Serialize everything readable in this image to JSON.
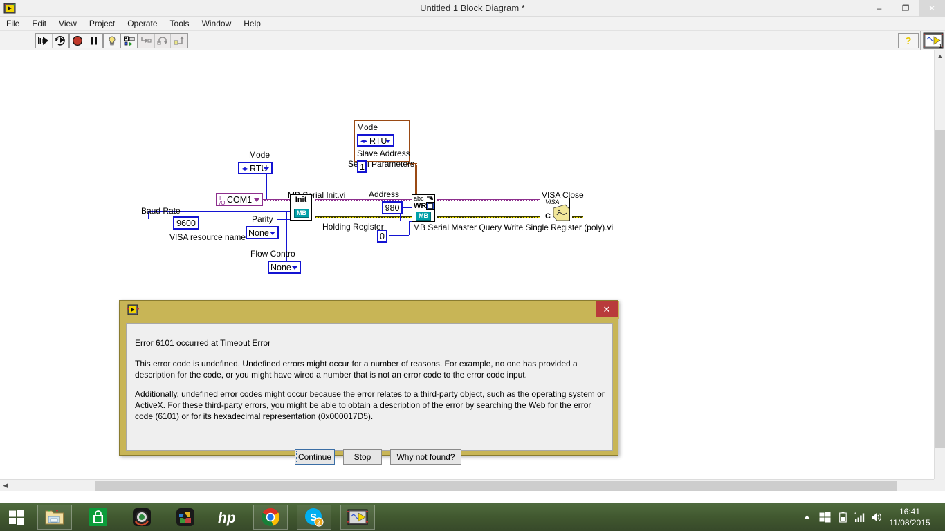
{
  "window": {
    "title": "Untitled 1 Block Diagram *",
    "app_icon": "labview-icon",
    "minimize": "–",
    "maximize": "❐",
    "close": "✕"
  },
  "menubar": {
    "items": [
      {
        "label": "File"
      },
      {
        "label": "Edit"
      },
      {
        "label": "View"
      },
      {
        "label": "Project"
      },
      {
        "label": "Operate"
      },
      {
        "label": "Tools"
      },
      {
        "label": "Window"
      },
      {
        "label": "Help"
      }
    ]
  },
  "toolbar": {
    "buttons": [
      {
        "name": "run-button",
        "icon": "run-arrow-icon"
      },
      {
        "name": "run-continuously-button",
        "icon": "run-continuous-icon"
      },
      {
        "name": "abort-execution-button",
        "icon": "abort-stop-icon"
      },
      {
        "name": "pause-button",
        "icon": "pause-icon"
      },
      {
        "name": "highlight-execution-button",
        "icon": "lightbulb-icon"
      },
      {
        "name": "retain-wire-values-button",
        "icon": "retain-wire-values-icon"
      },
      {
        "name": "step-into-button",
        "icon": "step-into-icon"
      },
      {
        "name": "step-over-button",
        "icon": "step-over-icon"
      },
      {
        "name": "step-out-button",
        "icon": "step-out-icon"
      }
    ],
    "help_button": "?",
    "vi_icon_number": "1"
  },
  "diagram": {
    "controls": [
      {
        "name": "mode-label",
        "text": "Mode"
      },
      {
        "name": "mode-ring-control",
        "value": "RTU"
      },
      {
        "name": "visa-resource-name-label",
        "text": "VISA resource name"
      },
      {
        "name": "visa-resource-name-control",
        "value": "COM1"
      },
      {
        "name": "baud-rate-label",
        "text": "Baud Rate"
      },
      {
        "name": "baud-rate-control",
        "value": "9600"
      },
      {
        "name": "parity-label",
        "text": "Parity"
      },
      {
        "name": "parity-control",
        "value": "None"
      },
      {
        "name": "flow-control-label",
        "text": "Flow Contro"
      },
      {
        "name": "flow-control-control",
        "value": "None"
      },
      {
        "name": "address-label",
        "text": "Address"
      },
      {
        "name": "address-control",
        "value": "980"
      },
      {
        "name": "holding-register-label",
        "text": "Holding Register"
      },
      {
        "name": "holding-register-control",
        "value": "0"
      }
    ],
    "cluster": {
      "title": "Serial Parameters",
      "fields": [
        {
          "label": "Mode",
          "value": "RTU"
        },
        {
          "label": "Slave Address",
          "value": "1"
        }
      ]
    },
    "nodes": [
      {
        "name": "mb-serial-init-vi",
        "label": "MB Serial Init.vi",
        "icon_text": "Init",
        "badge": "MB"
      },
      {
        "name": "mb-write-single-register-vi",
        "label": "MB Serial Master Query Write Single Register (poly).vi",
        "icon_text_top": "abc",
        "icon_text_mid": "WR",
        "badge": "MB"
      },
      {
        "name": "visa-close-vi",
        "label": "VISA Close",
        "icon_text_top": "VISA",
        "icon_text_bottom": "C"
      }
    ]
  },
  "error_dialog": {
    "title_icon": "labview-error-icon",
    "close_label": "✕",
    "heading": "Error 6101 occurred at Timeout Error",
    "paragraph1": "This error code is undefined. Undefined errors might occur for a number of reasons. For example, no one has provided a description for the code, or you might have wired a number that is not an error code to the error code input.",
    "paragraph2": "Additionally, undefined error codes might occur because the error relates to a third-party object, such as the operating system or ActiveX. For these third-party errors, you might be able to obtain a description of the error by searching the Web for the error code (6101) or for its hexadecimal representation (0x000017D5).",
    "buttons": [
      {
        "name": "continue-button",
        "label": "Continue",
        "focused": true
      },
      {
        "name": "stop-button",
        "label": "Stop",
        "focused": false
      },
      {
        "name": "why-not-found-button",
        "label": "Why not found?",
        "focused": false
      }
    ]
  },
  "taskbar": {
    "start": "start-button-icon",
    "apps": [
      {
        "name": "taskbar-file-explorer",
        "icon": "folder-icon",
        "open": true
      },
      {
        "name": "taskbar-store",
        "icon": "store-bag-icon",
        "open": false
      },
      {
        "name": "taskbar-media",
        "icon": "camera-lens-icon",
        "open": false
      },
      {
        "name": "taskbar-puzzle",
        "icon": "puzzle-icon",
        "open": false
      },
      {
        "name": "taskbar-hp",
        "icon": "hp-logo-icon",
        "open": false
      },
      {
        "name": "taskbar-chrome",
        "icon": "chrome-icon",
        "open": true
      },
      {
        "name": "taskbar-skype",
        "icon": "skype-icon",
        "open": true,
        "badge": "2"
      },
      {
        "name": "taskbar-labview",
        "icon": "labview-icon",
        "open": true
      }
    ],
    "tray": [
      {
        "name": "tray-show-hidden-icons",
        "icon": "chevron-up-icon"
      },
      {
        "name": "tray-windows-icon",
        "icon": "windows-flag-icon"
      },
      {
        "name": "tray-battery-icon",
        "icon": "battery-icon"
      },
      {
        "name": "tray-network-icon",
        "icon": "network-signal-icon"
      },
      {
        "name": "tray-volume-icon",
        "icon": "speaker-icon"
      }
    ],
    "clock": {
      "time": "16:41",
      "date": "11/08/2015"
    }
  },
  "colors": {
    "dialog_frame": "#c8b556",
    "control_blue": "#1414d2",
    "visa_purple": "#8d2f8d",
    "cluster_brown": "#9a4a14",
    "error_wire_yellow": "#f2e400",
    "mb_badge": "#00a0a8",
    "close_red": "#b93b3b",
    "taskbar_green": "#41582f"
  }
}
